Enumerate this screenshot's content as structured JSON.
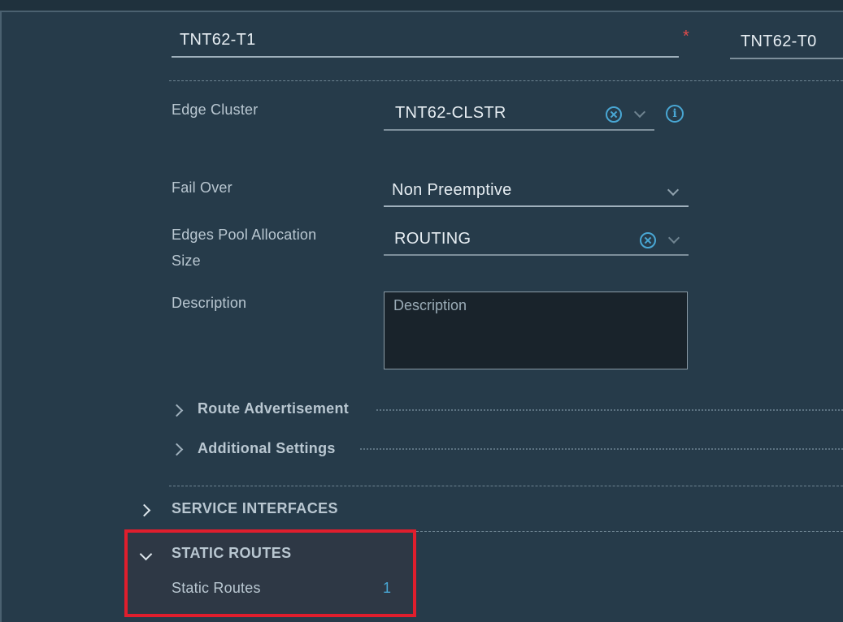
{
  "form": {
    "name_value": "TNT62-T1",
    "required_marker": "*",
    "linked_gateway_value": "TNT62-T0",
    "fields": {
      "edge_cluster": {
        "label": "Edge Cluster",
        "value": "TNT62-CLSTR"
      },
      "fail_over": {
        "label": "Fail Over",
        "value": "Non Preemptive"
      },
      "edges_pool_allocation_size": {
        "label_line1": "Edges Pool Allocation",
        "label_line2": "Size",
        "value": "ROUTING"
      },
      "description": {
        "label": "Description",
        "placeholder": "Description",
        "value": ""
      }
    },
    "subsections": {
      "route_advertisement": "Route Advertisement",
      "additional_settings": "Additional Settings"
    }
  },
  "sections": {
    "service_interfaces": {
      "title": "SERVICE INTERFACES",
      "expanded": false
    },
    "static_routes": {
      "title": "STATIC ROUTES",
      "expanded": true,
      "item_label": "Static Routes",
      "count": "1"
    }
  },
  "colors": {
    "background": "#263b4a",
    "accent": "#49a7d4",
    "highlight_border": "#e01e2d",
    "required": "#e24b4b"
  }
}
